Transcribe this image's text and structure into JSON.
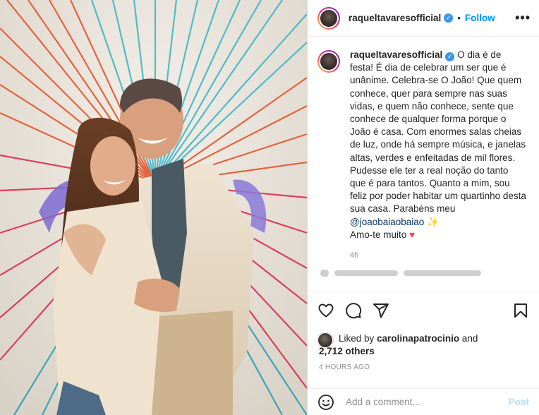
{
  "post": {
    "username": "raqueltavaresofficial",
    "follow_label": "Follow",
    "dot": "•",
    "more": "•••"
  },
  "caption": {
    "username": "raqueltavaresofficial",
    "text_before_mention": "O dia é de festa! É dia de celebrar um ser que é unânime. Celebra-se O João! Que quem conhece, quer para sempre nas suas vidas, e quem não conhece, sente que conhece de qualquer forma porque o João é casa. Com enormes salas cheias de luz, onde há sempre música, e janelas altas, verdes e enfeitadas de mil flores. Pudesse ele ter a real noção do tanto que é para tantos. Quanto a mim, sou feliz por poder habitar um quartinho desta sua casa. Parabéns meu",
    "mention": "@joaobaiaobaiao",
    "sparkle": "✨",
    "closing": "Amo-te muito",
    "heart": "❤️",
    "time": "4h"
  },
  "likes": {
    "liked_by_prefix": "Liked by",
    "liker": "carolinapatrocinio",
    "and": "and",
    "others": "2,712 others"
  },
  "posted_ago": "4 HOURS AGO",
  "comment_box": {
    "placeholder": "Add a comment...",
    "post_label": "Post"
  },
  "icons": {
    "like": "heart-outline-icon",
    "comment": "comment-bubble-icon",
    "share": "paper-plane-icon",
    "save": "bookmark-icon",
    "emoji": "smiley-icon",
    "verified": "verified-badge-icon"
  },
  "colors": {
    "accent": "#0095f6",
    "verified": "#3897f0",
    "heart": "#ed4956",
    "muted": "#8e8e8e",
    "post_disabled": "#b2dffc"
  }
}
